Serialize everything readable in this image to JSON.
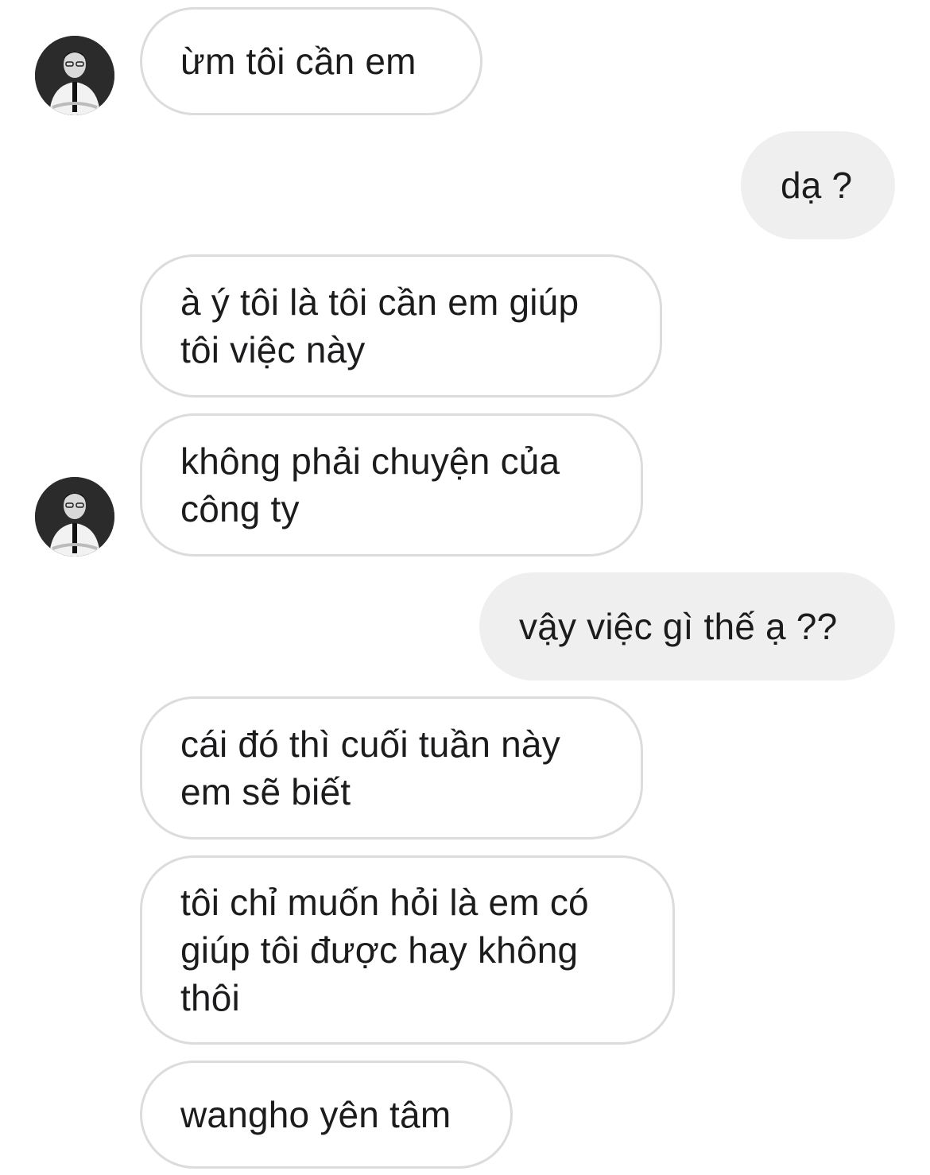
{
  "conversation": {
    "messages": [
      {
        "sender": "contact",
        "text": "ừm tôi cần em"
      },
      {
        "sender": "me",
        "text": "dạ ?"
      },
      {
        "sender": "contact",
        "text": "à ý tôi là tôi cần em giúp\ntôi việc này"
      },
      {
        "sender": "contact",
        "text": "không phải chuyện của\ncông ty"
      },
      {
        "sender": "me",
        "text": "vậy việc gì thế ạ ??"
      },
      {
        "sender": "contact",
        "text": "cái đó thì cuối tuần này\nem sẽ biết"
      },
      {
        "sender": "contact",
        "text": "tôi chỉ muốn hỏi là em có\ngiúp tôi được hay không\nthôi"
      },
      {
        "sender": "contact",
        "text": "wangho yên tâm"
      }
    ]
  },
  "colors": {
    "incoming_border": "#dcdcdc",
    "outgoing_fill": "#efefef",
    "text": "#1c1c1e"
  },
  "icons": {
    "avatar": "contact-avatar-icon"
  }
}
